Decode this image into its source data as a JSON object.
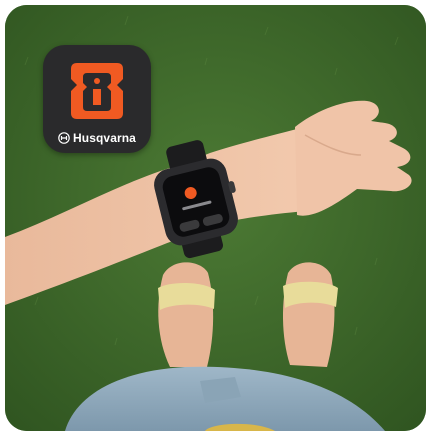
{
  "app": {
    "brand_name": "Husqvarna",
    "accent_color": "#f05a22",
    "icon_bg_color": "#2a2a2c"
  },
  "icons": {
    "app_icon": "husqvarna-automower-app-icon",
    "brand_mark": "husqvarna-crown-logo-icon"
  },
  "scene": {
    "background": "grass-lawn",
    "subject": "arm-with-smartwatch-and-feet-in-sandals"
  }
}
